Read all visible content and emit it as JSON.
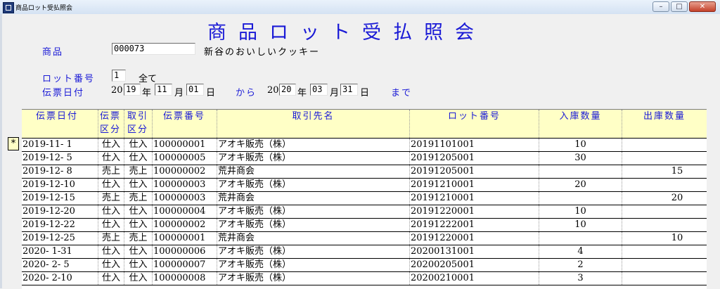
{
  "window": {
    "title": "商品ロット受払照会"
  },
  "form": {
    "title": "商品ロット受払照会",
    "product_label": "商品",
    "product_code": "000073",
    "product_name": "新谷のおいしいクッキー",
    "lot_label": "ロット番号",
    "lot_value": "1",
    "lot_desc": "全て",
    "date_label": "伝票日付",
    "from_year_prefix": "20",
    "from_year": "19",
    "year_char": "年",
    "from_month": "11",
    "month_char": "月",
    "from_day": "01",
    "day_char": "日",
    "from_word": "から",
    "to_year_prefix": "20",
    "to_year": "20",
    "to_month": "03",
    "to_day": "31",
    "until_word": "まで"
  },
  "grid": {
    "headers": {
      "date": "伝票日付",
      "voucher_type_1": "伝票",
      "voucher_type_2": "区分",
      "trans_type_1": "取引",
      "trans_type_2": "区分",
      "voucher_no": "伝票番号",
      "partner": "取引先名",
      "lot": "ロット番号",
      "in_qty": "入庫数量",
      "out_qty": "出庫数量"
    },
    "selector_symbol": "*",
    "rows": [
      {
        "date": "2019-11- 1",
        "vtype": "仕入",
        "ttype": "仕入",
        "vno": "100000001",
        "partner": "アオキ販売（株）",
        "lot": "20191101001",
        "in": "10",
        "out": ""
      },
      {
        "date": "2019-12- 5",
        "vtype": "仕入",
        "ttype": "仕入",
        "vno": "100000005",
        "partner": "アオキ販売（株）",
        "lot": "20191205001",
        "in": "30",
        "out": ""
      },
      {
        "date": "2019-12- 8",
        "vtype": "売上",
        "ttype": "売上",
        "vno": "100000002",
        "partner": "荒井商会",
        "lot": "20191205001",
        "in": "",
        "out": "15"
      },
      {
        "date": "2019-12-10",
        "vtype": "仕入",
        "ttype": "仕入",
        "vno": "100000003",
        "partner": "アオキ販売（株）",
        "lot": "20191210001",
        "in": "20",
        "out": ""
      },
      {
        "date": "2019-12-15",
        "vtype": "売上",
        "ttype": "売上",
        "vno": "100000003",
        "partner": "荒井商会",
        "lot": "20191210001",
        "in": "",
        "out": "20"
      },
      {
        "date": "2019-12-20",
        "vtype": "仕入",
        "ttype": "仕入",
        "vno": "100000004",
        "partner": "アオキ販売（株）",
        "lot": "20191220001",
        "in": "10",
        "out": ""
      },
      {
        "date": "2019-12-22",
        "vtype": "仕入",
        "ttype": "仕入",
        "vno": "100000002",
        "partner": "アオキ販売（株）",
        "lot": "20191222001",
        "in": "10",
        "out": ""
      },
      {
        "date": "2019-12-25",
        "vtype": "売上",
        "ttype": "売上",
        "vno": "100000001",
        "partner": "荒井商会",
        "lot": "20191220001",
        "in": "",
        "out": "10"
      },
      {
        "date": "2020- 1-31",
        "vtype": "仕入",
        "ttype": "仕入",
        "vno": "100000006",
        "partner": "アオキ販売（株）",
        "lot": "20200131001",
        "in": "4",
        "out": ""
      },
      {
        "date": "2020- 2- 5",
        "vtype": "仕入",
        "ttype": "仕入",
        "vno": "100000007",
        "partner": "アオキ販売（株）",
        "lot": "20200205001",
        "in": "2",
        "out": ""
      },
      {
        "date": "2020- 2-10",
        "vtype": "仕入",
        "ttype": "仕入",
        "vno": "100000008",
        "partner": "アオキ販売（株）",
        "lot": "20200210001",
        "in": "3",
        "out": ""
      }
    ]
  }
}
